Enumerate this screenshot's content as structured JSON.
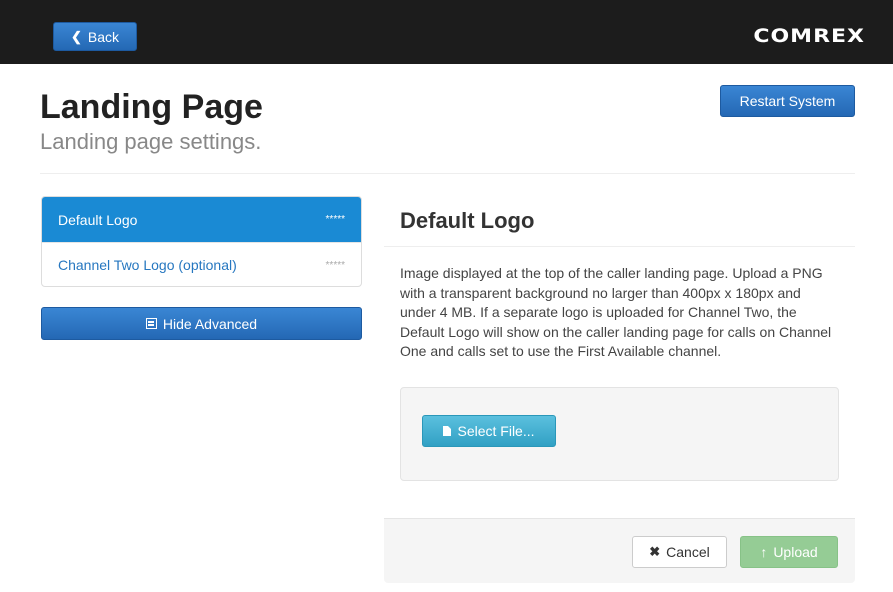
{
  "navbar": {
    "back_label": "Back",
    "brand": "COMREX"
  },
  "header": {
    "title": "Landing Page",
    "subtitle": "Landing page settings.",
    "restart_label": "Restart System"
  },
  "sidebar": {
    "items": [
      {
        "label": "Default Logo",
        "badge": "*****",
        "active": true
      },
      {
        "label": "Channel Two Logo (optional)",
        "badge": "*****",
        "active": false
      }
    ],
    "hide_advanced_label": "Hide Advanced"
  },
  "panel": {
    "title": "Default Logo",
    "description": "Image displayed at the top of the caller landing page. Upload a PNG with a transparent background no larger than 400px x 180px and under 4 MB. If a separate logo is uploaded for Channel Two, the Default Logo will show on the caller landing page for calls on Channel One and calls set to use the First Available channel.",
    "select_file_label": "Select File...",
    "cancel_label": "Cancel",
    "upload_label": "Upload"
  },
  "icons": {
    "back": "chevron-left-icon",
    "hide_advanced": "list-icon",
    "select_file": "file-icon",
    "cancel": "x-icon",
    "upload": "arrow-up-icon"
  },
  "colors": {
    "navbar": "#1c1c1c",
    "primary": "#2a76c6",
    "active_item": "#1a8ad4",
    "info": "#5bc0de",
    "success_disabled": "#95cc95"
  }
}
